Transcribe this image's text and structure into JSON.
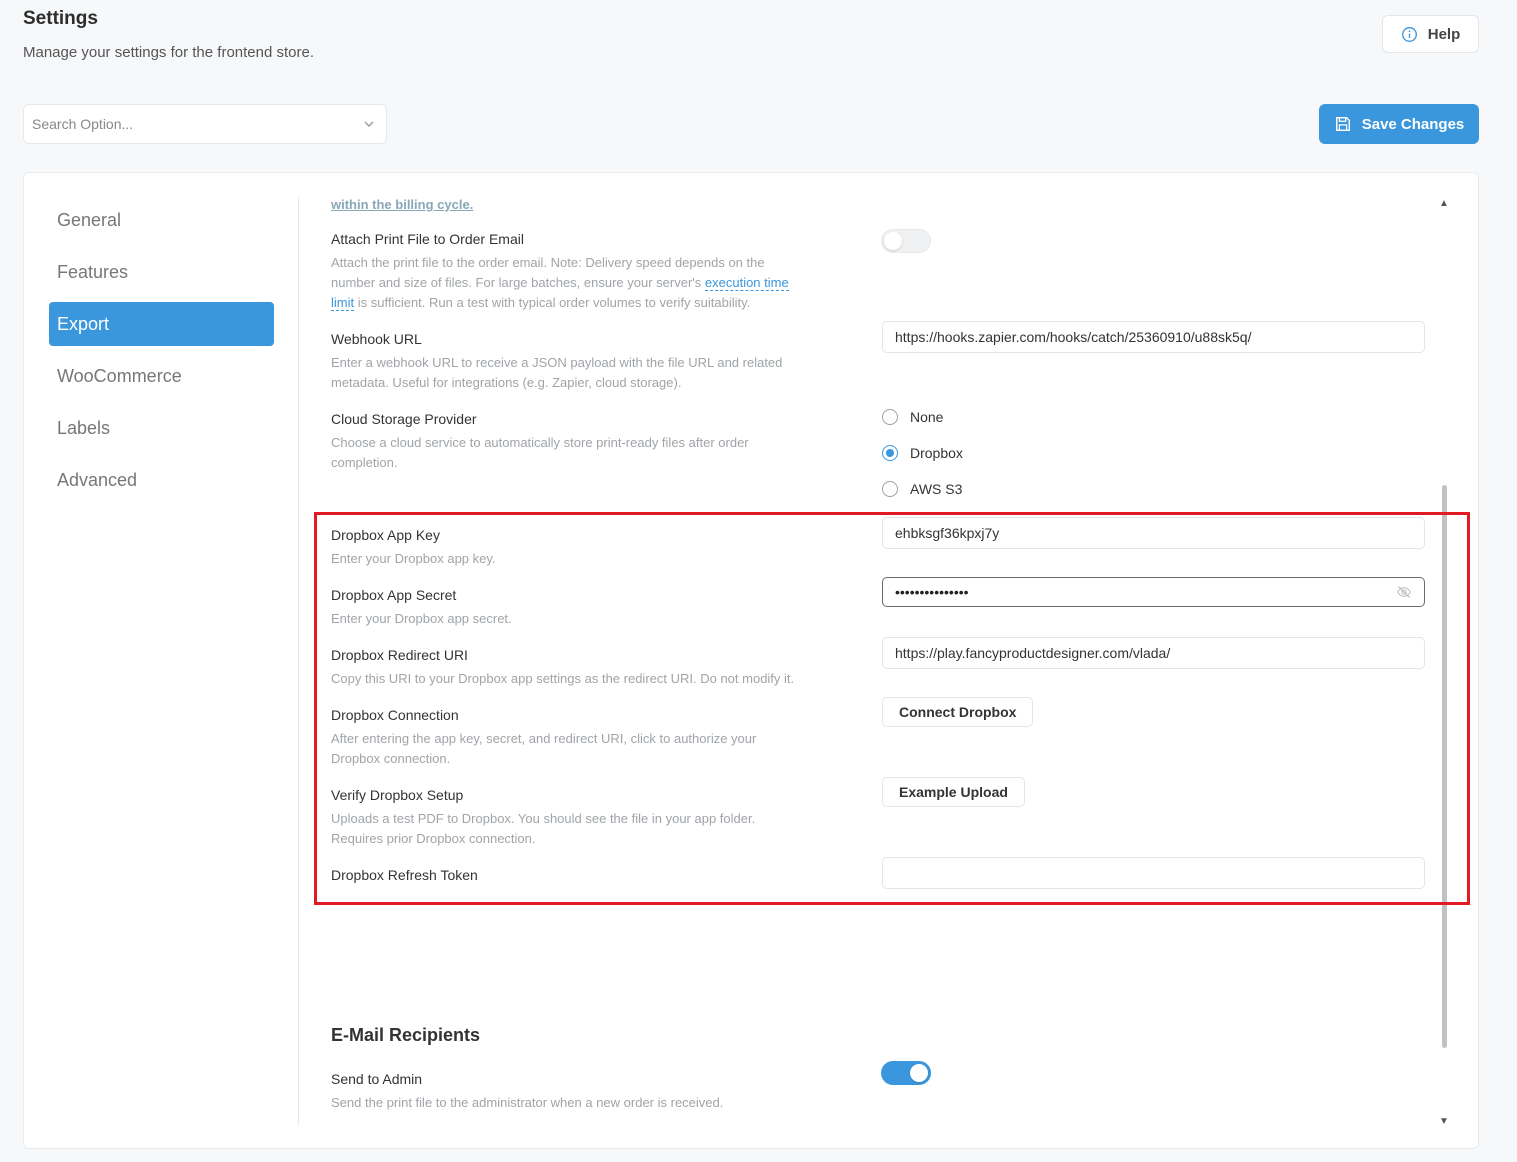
{
  "header": {
    "title": "Settings",
    "subtitle": "Manage your settings for the frontend store.",
    "help_label": "Help"
  },
  "search": {
    "placeholder": "Search Option..."
  },
  "save_label": "Save Changes",
  "sidebar": {
    "items": [
      {
        "label": "General",
        "active": false
      },
      {
        "label": "Features",
        "active": false
      },
      {
        "label": "Export",
        "active": true
      },
      {
        "label": "WooCommerce",
        "active": false
      },
      {
        "label": "Labels",
        "active": false
      },
      {
        "label": "Advanced",
        "active": false
      }
    ]
  },
  "content": {
    "cut_link": "within the billing cycle.",
    "attach_print": {
      "label": "Attach Print File to Order Email",
      "desc_before": "Attach the print file to the order email. Note: Delivery speed depends on the number and size of files. For large batches, ensure your server's ",
      "desc_link": "execution time limit",
      "desc_after": " is sufficient. Run a test with typical order volumes to verify suitability.",
      "enabled": false
    },
    "webhook": {
      "label": "Webhook URL",
      "desc": "Enter a webhook URL to receive a JSON payload with the file URL and related metadata. Useful for integrations (e.g. Zapier, cloud storage).",
      "value": "https://hooks.zapier.com/hooks/catch/25360910/u88sk5q/"
    },
    "cloud_storage": {
      "label": "Cloud Storage Provider",
      "desc": "Choose a cloud service to automatically store print-ready files after order completion.",
      "options": [
        "None",
        "Dropbox",
        "AWS S3"
      ],
      "selected": "Dropbox"
    },
    "dropbox_app_key": {
      "label": "Dropbox App Key",
      "desc": "Enter your Dropbox app key.",
      "value": "ehbksgf36kpxj7y"
    },
    "dropbox_app_secret": {
      "label": "Dropbox App Secret",
      "desc": "Enter your Dropbox app secret.",
      "masked_value": "•••••••••••••••"
    },
    "dropbox_redirect": {
      "label": "Dropbox Redirect URI",
      "desc": "Copy this URI to your Dropbox app settings as the redirect URI. Do not modify it.",
      "value": "https://play.fancyproductdesigner.com/vlada/"
    },
    "dropbox_connection": {
      "label": "Dropbox Connection",
      "desc": "After entering the app key, secret, and redirect URI, click to authorize your Dropbox connection.",
      "button": "Connect Dropbox"
    },
    "verify_dropbox": {
      "label": "Verify Dropbox Setup",
      "desc": "Uploads a test PDF to Dropbox. You should see the file in your app folder. Requires prior Dropbox connection.",
      "button": "Example Upload"
    },
    "dropbox_refresh": {
      "label": "Dropbox Refresh Token",
      "value": ""
    },
    "email_section": {
      "title": "E-Mail Recipients"
    },
    "send_to_admin": {
      "label": "Send to Admin",
      "desc": "Send the print file to the administrator when a new order is received.",
      "enabled": true
    }
  },
  "colors": {
    "accent": "#3b97dd",
    "highlight": "#e01b24"
  }
}
